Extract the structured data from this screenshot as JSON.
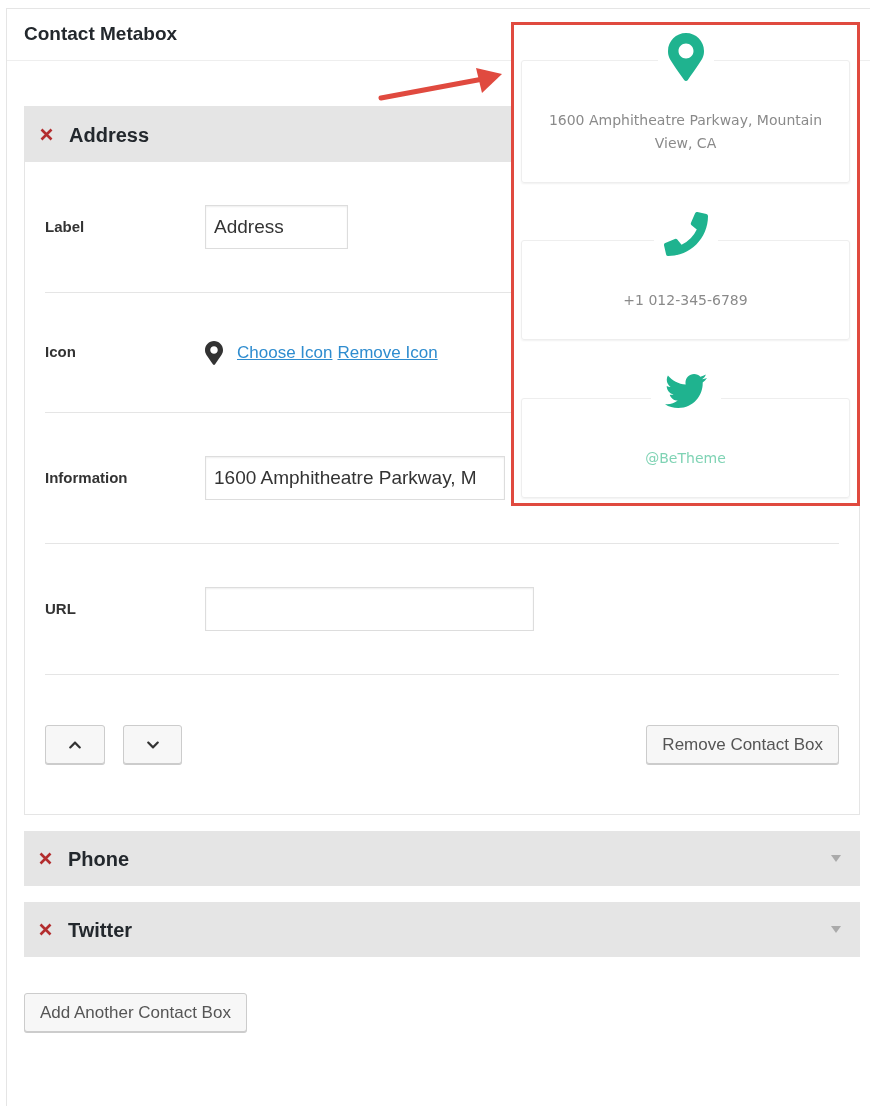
{
  "panel": {
    "title": "Contact Metabox"
  },
  "contact_boxes": [
    {
      "title": "Address",
      "expanded": true,
      "fields": [
        {
          "kind": "text",
          "label": "Label",
          "value": "Address"
        },
        {
          "kind": "icon",
          "label": "Icon",
          "links": [
            "Choose Icon",
            "Remove Icon"
          ]
        },
        {
          "kind": "text",
          "label": "Information",
          "value": "1600 Amphitheatre Parkway, M"
        },
        {
          "kind": "text",
          "label": "URL"
        }
      ],
      "remove_button": "Remove Contact Box"
    },
    {
      "title": "Phone",
      "expanded": false
    },
    {
      "title": "Twitter",
      "expanded": false
    }
  ],
  "add_button": "Add Another Contact Box",
  "preview": {
    "items": [
      {
        "kind": "pin",
        "text": "1600 Amphitheatre Parkway, Mountain View, CA",
        "color": "#8a8a8a"
      },
      {
        "kind": "phone",
        "text": "+1 012-345-6789",
        "color": "#8a8a8a"
      },
      {
        "kind": "bird",
        "text": "@BeTheme",
        "color": "#7fd3b4"
      }
    ]
  }
}
